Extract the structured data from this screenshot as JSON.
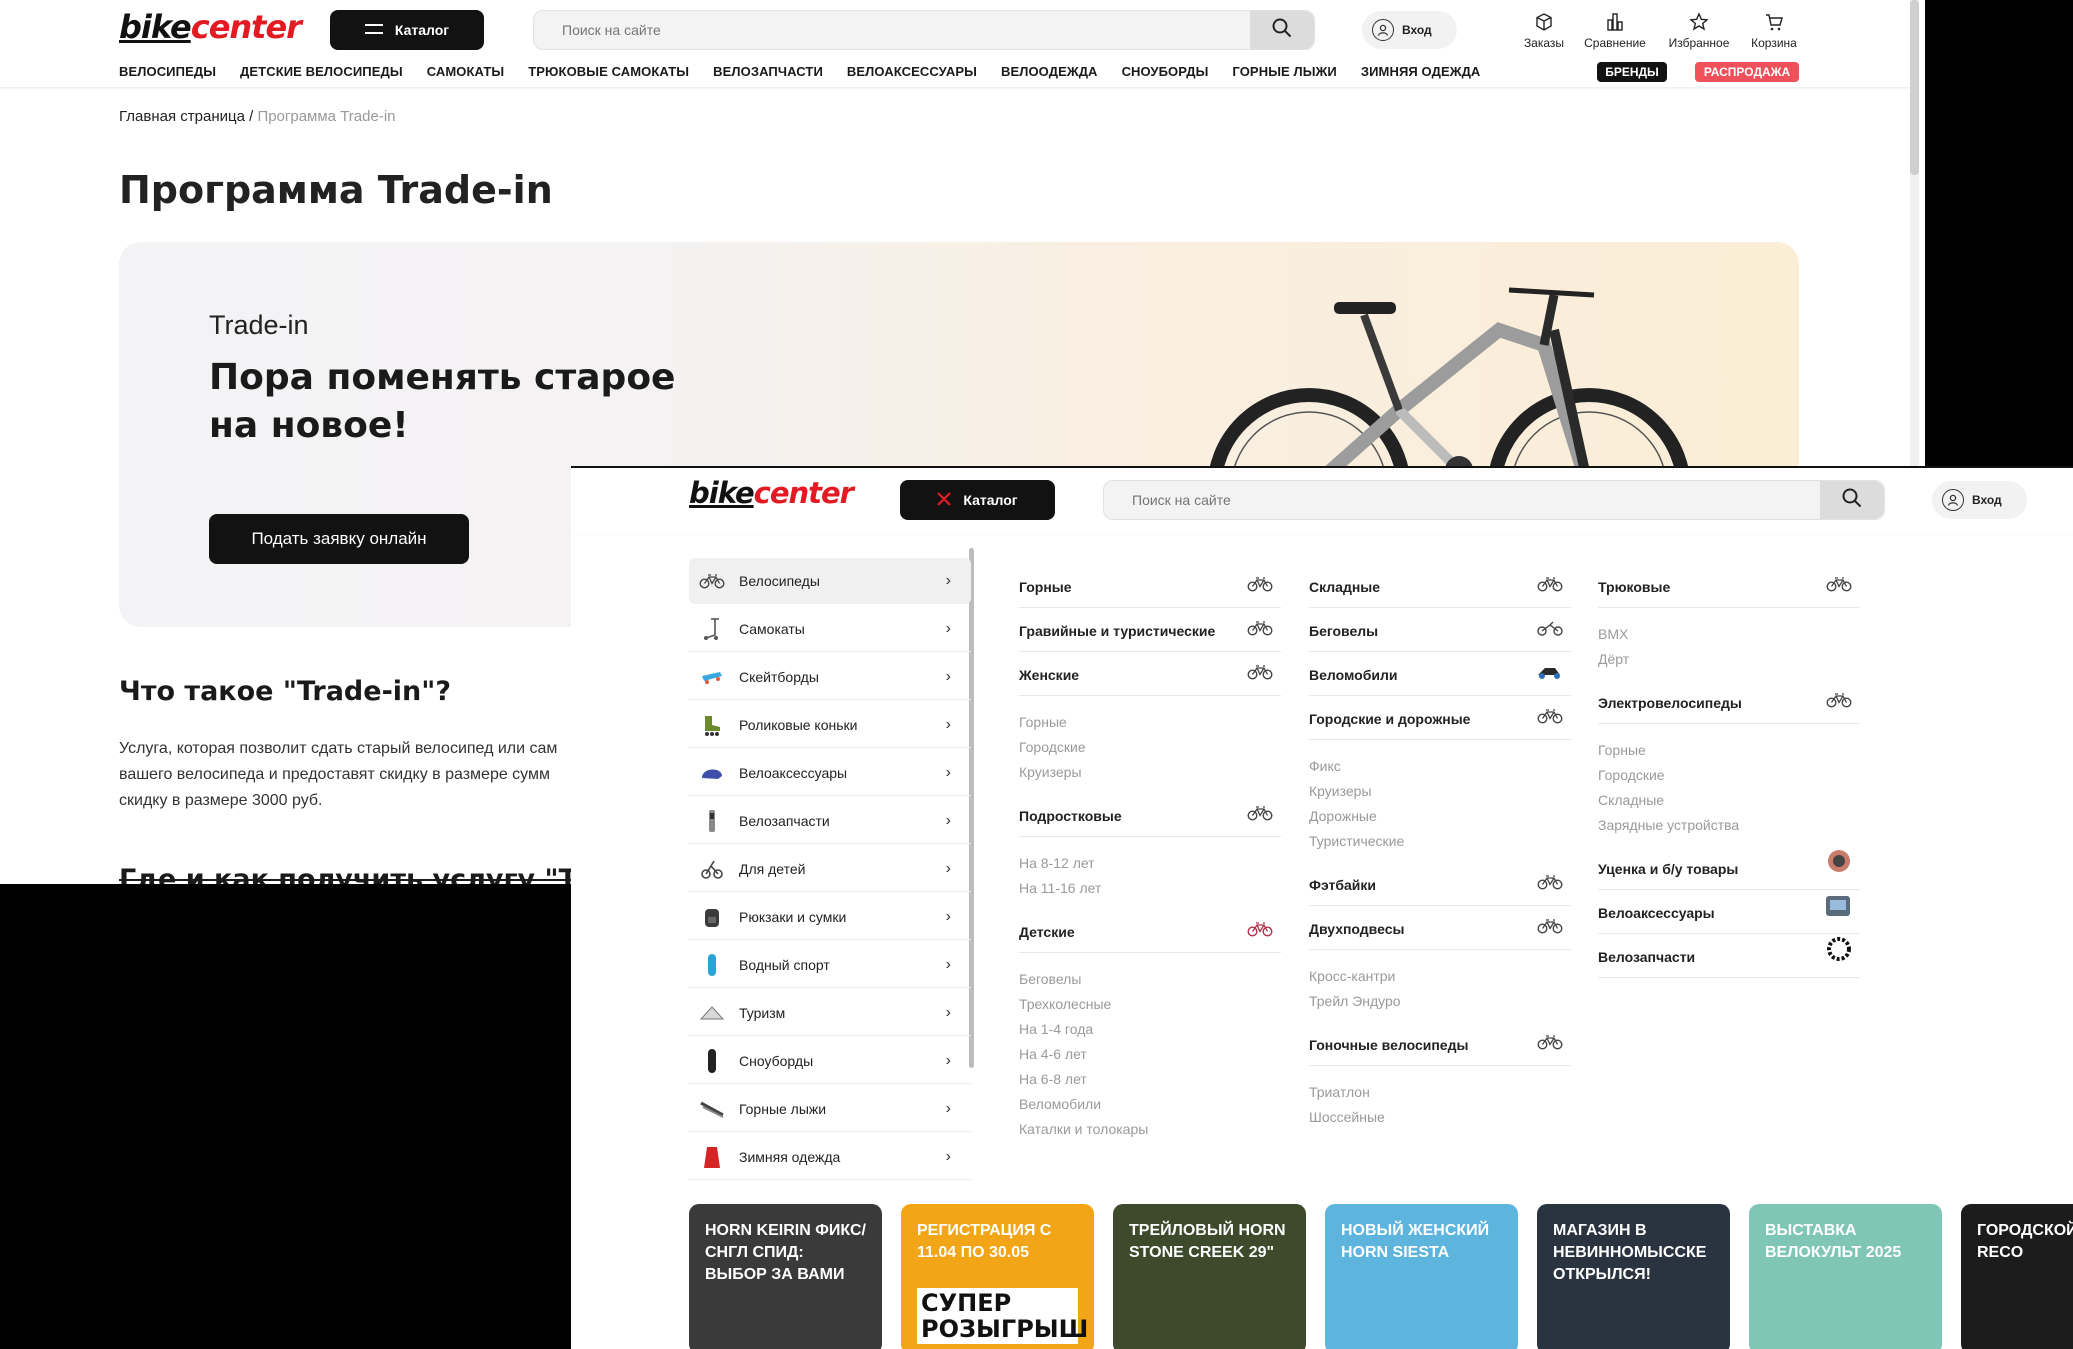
{
  "brand": {
    "logo_part1": "bike",
    "logo_part2": "center"
  },
  "header": {
    "catalog_label": "Каталог",
    "search_placeholder": "Поиск на сайте",
    "login_label": "Вход",
    "icons": [
      {
        "name": "orders",
        "label": "Заказы"
      },
      {
        "name": "compare",
        "label": "Сравнение"
      },
      {
        "name": "favorites",
        "label": "Избранное"
      },
      {
        "name": "cart",
        "label": "Корзина"
      }
    ]
  },
  "topnav": [
    "ВЕЛОСИПЕДЫ",
    "ДЕТСКИЕ ВЕЛОСИПЕДЫ",
    "САМОКАТЫ",
    "ТРЮКОВЫЕ САМОКАТЫ",
    "ВЕЛОЗАПЧАСТИ",
    "ВЕЛОАКСЕССУАРЫ",
    "ВЕЛООДЕЖДА",
    "СНОУБОРДЫ",
    "ГОРНЫЕ ЛЫЖИ",
    "ЗИМНЯЯ ОДЕЖДА"
  ],
  "nav_badges": {
    "brands": "БРЕНДЫ",
    "sale": "РАСПРОДАЖА"
  },
  "colors": {
    "accent_red": "#e21b23",
    "sale_badge": "#f0505a",
    "dark": "#121212"
  },
  "breadcrumb": {
    "home": "Главная страница",
    "separator": "/",
    "current": "Программа Trade-in"
  },
  "page": {
    "title": "Программа Trade-in",
    "banner_kicker": "Trade-in",
    "banner_heading": "Пора поменять старое на новое!",
    "banner_cta": "Подать заявку онлайн",
    "what_heading": "Что такое \"Trade-in\"?",
    "what_text": "Услуга, которая позволит сдать старый велосипед или сам вашего велосипеда и предоставят скидку в размере сумм скидку в размере 3000 руб.",
    "where_heading": "Где и как получить услугу \"Trade"
  },
  "catalog": {
    "categories": [
      {
        "label": "Велосипеды",
        "icon": "bicycle-icon",
        "active": true
      },
      {
        "label": "Самокаты",
        "icon": "scooter-icon"
      },
      {
        "label": "Скейтборды",
        "icon": "skateboard-icon"
      },
      {
        "label": "Роликовые коньки",
        "icon": "rollerskate-icon"
      },
      {
        "label": "Велоаксессуары",
        "icon": "helmet-icon"
      },
      {
        "label": "Велозапчасти",
        "icon": "bikepart-icon"
      },
      {
        "label": "Для детей",
        "icon": "kids-bike-icon"
      },
      {
        "label": "Рюкзаки и сумки",
        "icon": "backpack-icon"
      },
      {
        "label": "Водный спорт",
        "icon": "water-sport-icon"
      },
      {
        "label": "Туризм",
        "icon": "tent-icon"
      },
      {
        "label": "Сноуборды",
        "icon": "snowboard-icon"
      },
      {
        "label": "Горные лыжи",
        "icon": "ski-icon"
      },
      {
        "label": "Зимняя одежда",
        "icon": "jacket-icon"
      }
    ],
    "columns": [
      [
        {
          "title": "Горные",
          "items": []
        },
        {
          "title": "Гравийные и туристические",
          "items": []
        },
        {
          "title": "Женские",
          "items": [
            "Горные",
            "Городские",
            "Круизеры"
          ]
        },
        {
          "title": "Подростковые",
          "items": [
            "На 8-12 лет",
            "На 11-16 лет"
          ]
        },
        {
          "title": "Детские",
          "items": [
            "Беговелы",
            "Трехколесные",
            "На 1-4 года",
            "На 4-6 лет",
            "На 6-8 лет",
            "Веломобили",
            "Каталки и толокары"
          ]
        }
      ],
      [
        {
          "title": "Складные",
          "items": []
        },
        {
          "title": "Беговелы",
          "items": []
        },
        {
          "title": "Веломобили",
          "items": []
        },
        {
          "title": "Городские и дорожные",
          "items": [
            "Фикс",
            "Круизеры",
            "Дорожные",
            "Туристические"
          ]
        },
        {
          "title": "Фэтбайки",
          "items": []
        },
        {
          "title": "Двухподвесы",
          "items": [
            "Кросс-кантри",
            "Трейл Эндуро"
          ]
        },
        {
          "title": "Гоночные велосипеды",
          "items": [
            "Триатлон",
            "Шоссейные"
          ]
        }
      ],
      [
        {
          "title": "Трюковые",
          "items": [
            "BMX",
            "Дёрт"
          ]
        },
        {
          "title": "Электровелосипеды",
          "items": [
            "Горные",
            "Городские",
            "Складные",
            "Зарядные устройства"
          ]
        },
        {
          "title": "Уценка и б/у товары",
          "items": []
        },
        {
          "title": "Велоаксессуары",
          "items": []
        },
        {
          "title": "Велозапчасти",
          "items": []
        }
      ]
    ]
  },
  "promos": [
    {
      "text": "HORN KEIRIN ФИКС/СНГЛ СПИД: ВЫБОР ЗА ВАМИ",
      "bg": "#3a3a3a"
    },
    {
      "text": "РЕГИСТРАЦИЯ С 11.04 ПО 30.05",
      "bg": "#f2a516",
      "big": "СУПЕР РОЗЫГРЫШ"
    },
    {
      "text": "ТРЕЙЛОВЫЙ HORN STONE CREEK 29\"",
      "bg": "#3d4a2c"
    },
    {
      "text": "НОВЫЙ ЖЕНСКИЙ HORN SIESTA",
      "bg": "#5db4dc"
    },
    {
      "text": "МАГАЗИН В НЕВИННОМЫССКЕ ОТКРЫЛСЯ!",
      "bg": "#2a3340"
    },
    {
      "text": "ВЫСТАВКА ВЕЛОКУЛЬТ 2025",
      "bg": "#7fc6b6"
    },
    {
      "text": "ГОРОДСКОЙ HORN RECO",
      "bg": "#1c1c1c"
    }
  ]
}
